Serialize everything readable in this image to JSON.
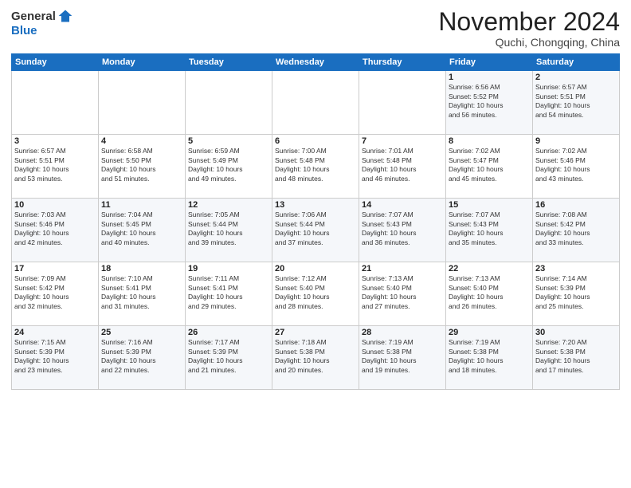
{
  "logo": {
    "general": "General",
    "blue": "Blue"
  },
  "title": "November 2024",
  "subtitle": "Quchi, Chongqing, China",
  "headers": [
    "Sunday",
    "Monday",
    "Tuesday",
    "Wednesday",
    "Thursday",
    "Friday",
    "Saturday"
  ],
  "weeks": [
    [
      {
        "day": "",
        "info": ""
      },
      {
        "day": "",
        "info": ""
      },
      {
        "day": "",
        "info": ""
      },
      {
        "day": "",
        "info": ""
      },
      {
        "day": "",
        "info": ""
      },
      {
        "day": "1",
        "info": "Sunrise: 6:56 AM\nSunset: 5:52 PM\nDaylight: 10 hours\nand 56 minutes."
      },
      {
        "day": "2",
        "info": "Sunrise: 6:57 AM\nSunset: 5:51 PM\nDaylight: 10 hours\nand 54 minutes."
      }
    ],
    [
      {
        "day": "3",
        "info": "Sunrise: 6:57 AM\nSunset: 5:51 PM\nDaylight: 10 hours\nand 53 minutes."
      },
      {
        "day": "4",
        "info": "Sunrise: 6:58 AM\nSunset: 5:50 PM\nDaylight: 10 hours\nand 51 minutes."
      },
      {
        "day": "5",
        "info": "Sunrise: 6:59 AM\nSunset: 5:49 PM\nDaylight: 10 hours\nand 49 minutes."
      },
      {
        "day": "6",
        "info": "Sunrise: 7:00 AM\nSunset: 5:48 PM\nDaylight: 10 hours\nand 48 minutes."
      },
      {
        "day": "7",
        "info": "Sunrise: 7:01 AM\nSunset: 5:48 PM\nDaylight: 10 hours\nand 46 minutes."
      },
      {
        "day": "8",
        "info": "Sunrise: 7:02 AM\nSunset: 5:47 PM\nDaylight: 10 hours\nand 45 minutes."
      },
      {
        "day": "9",
        "info": "Sunrise: 7:02 AM\nSunset: 5:46 PM\nDaylight: 10 hours\nand 43 minutes."
      }
    ],
    [
      {
        "day": "10",
        "info": "Sunrise: 7:03 AM\nSunset: 5:46 PM\nDaylight: 10 hours\nand 42 minutes."
      },
      {
        "day": "11",
        "info": "Sunrise: 7:04 AM\nSunset: 5:45 PM\nDaylight: 10 hours\nand 40 minutes."
      },
      {
        "day": "12",
        "info": "Sunrise: 7:05 AM\nSunset: 5:44 PM\nDaylight: 10 hours\nand 39 minutes."
      },
      {
        "day": "13",
        "info": "Sunrise: 7:06 AM\nSunset: 5:44 PM\nDaylight: 10 hours\nand 37 minutes."
      },
      {
        "day": "14",
        "info": "Sunrise: 7:07 AM\nSunset: 5:43 PM\nDaylight: 10 hours\nand 36 minutes."
      },
      {
        "day": "15",
        "info": "Sunrise: 7:07 AM\nSunset: 5:43 PM\nDaylight: 10 hours\nand 35 minutes."
      },
      {
        "day": "16",
        "info": "Sunrise: 7:08 AM\nSunset: 5:42 PM\nDaylight: 10 hours\nand 33 minutes."
      }
    ],
    [
      {
        "day": "17",
        "info": "Sunrise: 7:09 AM\nSunset: 5:42 PM\nDaylight: 10 hours\nand 32 minutes."
      },
      {
        "day": "18",
        "info": "Sunrise: 7:10 AM\nSunset: 5:41 PM\nDaylight: 10 hours\nand 31 minutes."
      },
      {
        "day": "19",
        "info": "Sunrise: 7:11 AM\nSunset: 5:41 PM\nDaylight: 10 hours\nand 29 minutes."
      },
      {
        "day": "20",
        "info": "Sunrise: 7:12 AM\nSunset: 5:40 PM\nDaylight: 10 hours\nand 28 minutes."
      },
      {
        "day": "21",
        "info": "Sunrise: 7:13 AM\nSunset: 5:40 PM\nDaylight: 10 hours\nand 27 minutes."
      },
      {
        "day": "22",
        "info": "Sunrise: 7:13 AM\nSunset: 5:40 PM\nDaylight: 10 hours\nand 26 minutes."
      },
      {
        "day": "23",
        "info": "Sunrise: 7:14 AM\nSunset: 5:39 PM\nDaylight: 10 hours\nand 25 minutes."
      }
    ],
    [
      {
        "day": "24",
        "info": "Sunrise: 7:15 AM\nSunset: 5:39 PM\nDaylight: 10 hours\nand 23 minutes."
      },
      {
        "day": "25",
        "info": "Sunrise: 7:16 AM\nSunset: 5:39 PM\nDaylight: 10 hours\nand 22 minutes."
      },
      {
        "day": "26",
        "info": "Sunrise: 7:17 AM\nSunset: 5:39 PM\nDaylight: 10 hours\nand 21 minutes."
      },
      {
        "day": "27",
        "info": "Sunrise: 7:18 AM\nSunset: 5:38 PM\nDaylight: 10 hours\nand 20 minutes."
      },
      {
        "day": "28",
        "info": "Sunrise: 7:19 AM\nSunset: 5:38 PM\nDaylight: 10 hours\nand 19 minutes."
      },
      {
        "day": "29",
        "info": "Sunrise: 7:19 AM\nSunset: 5:38 PM\nDaylight: 10 hours\nand 18 minutes."
      },
      {
        "day": "30",
        "info": "Sunrise: 7:20 AM\nSunset: 5:38 PM\nDaylight: 10 hours\nand 17 minutes."
      }
    ]
  ]
}
